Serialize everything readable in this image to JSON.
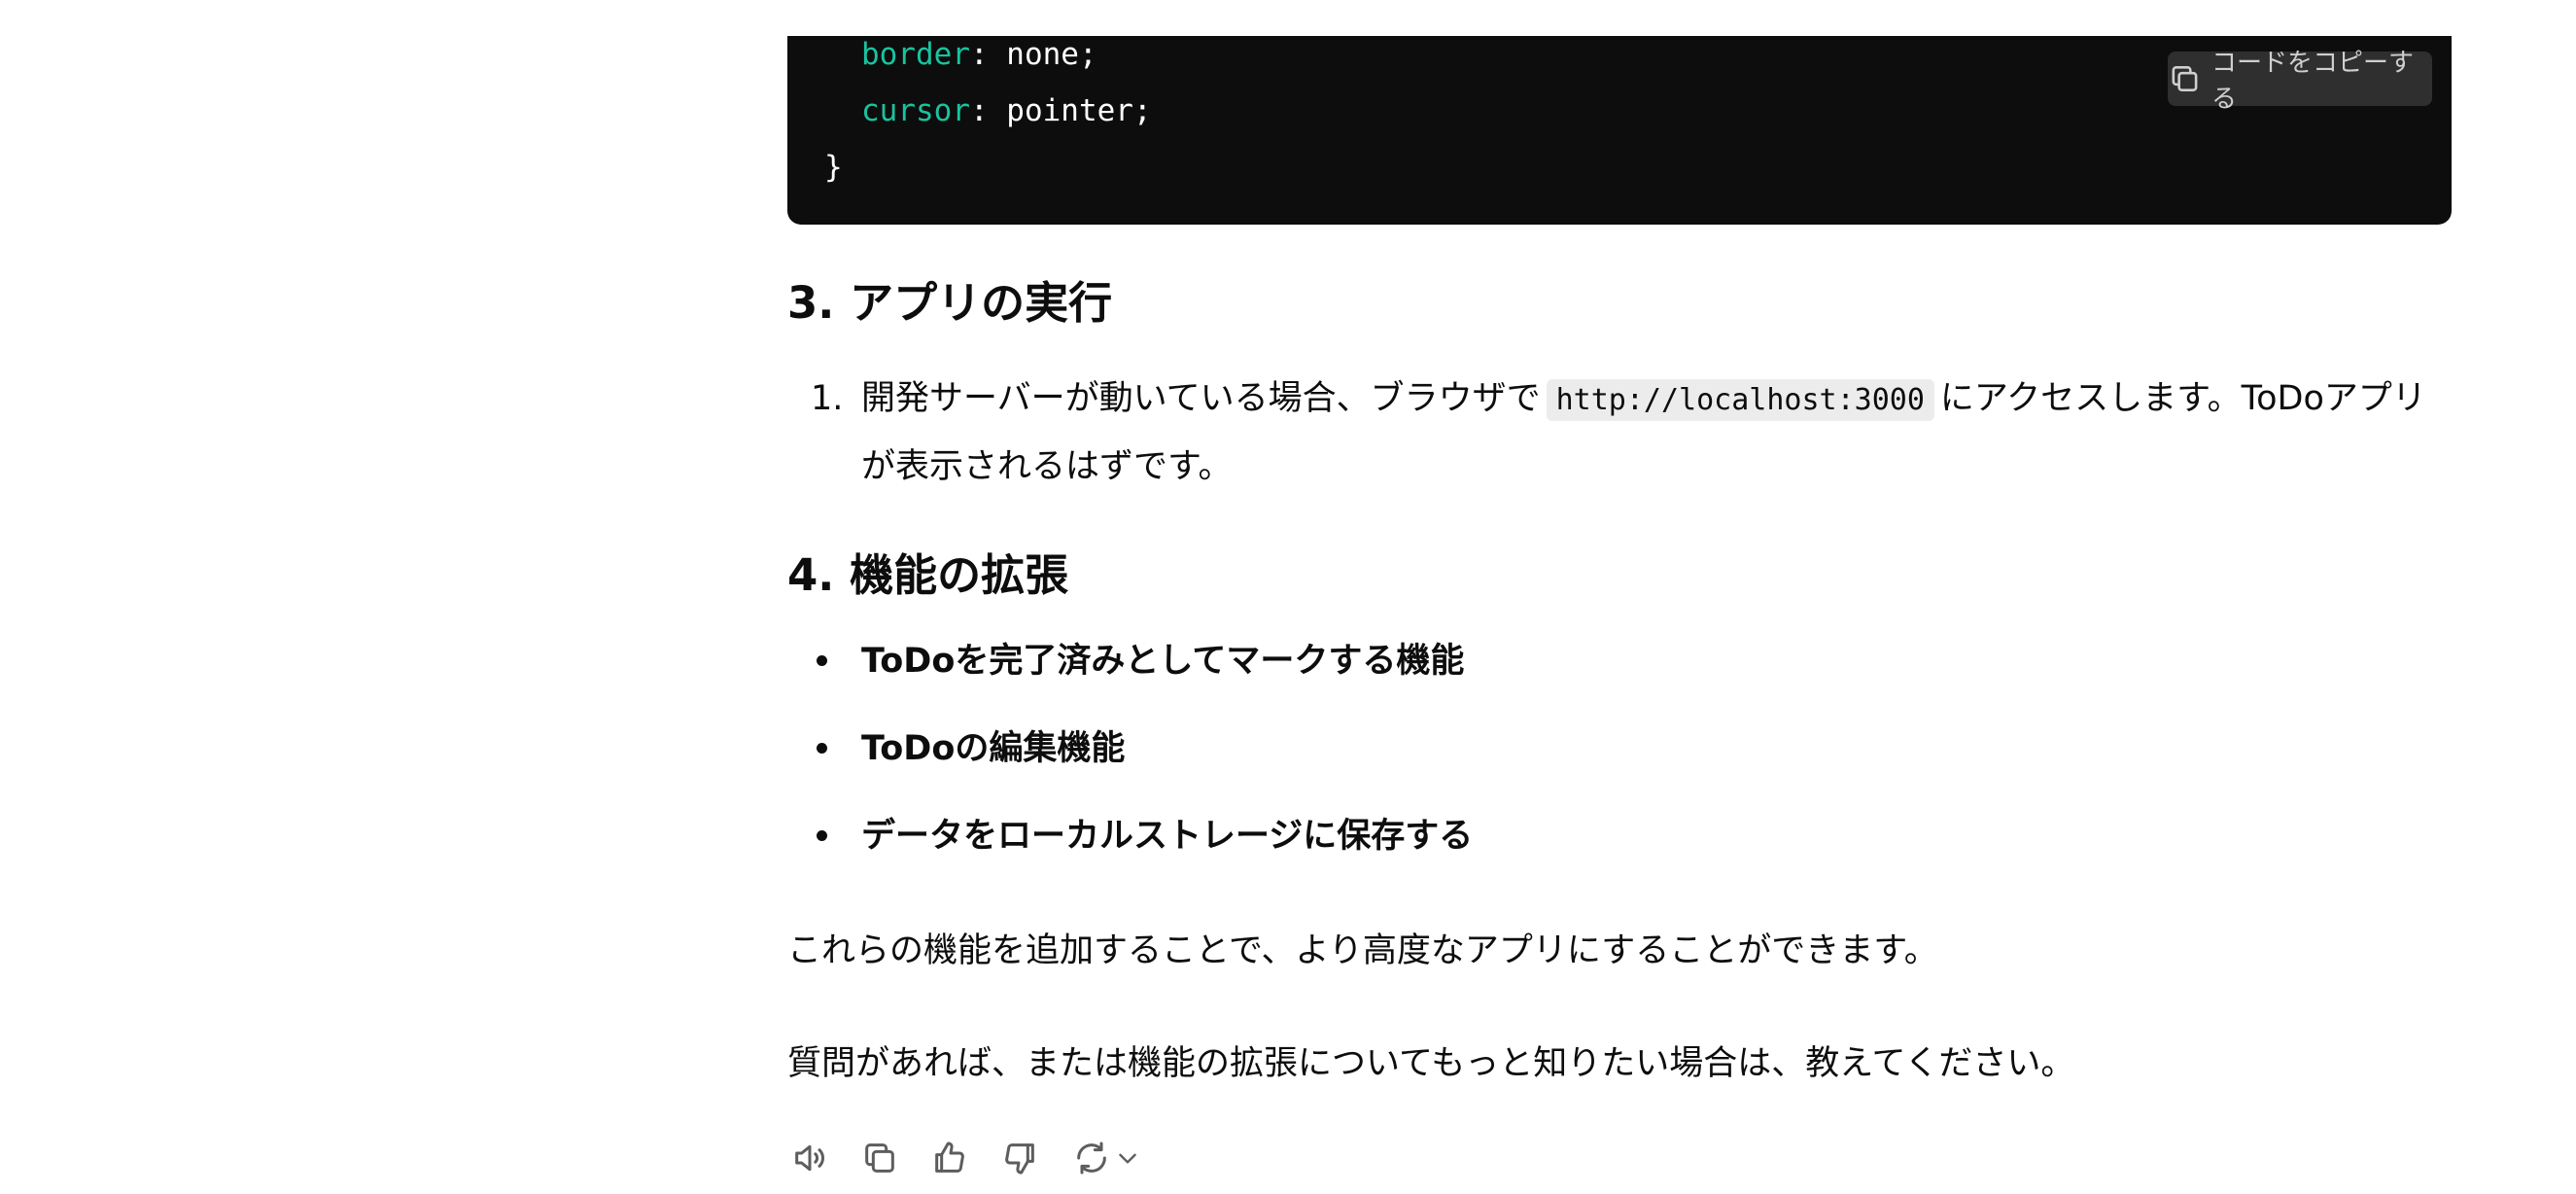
{
  "code_block": {
    "lines": [
      {
        "prop": "border",
        "rest": ": none;"
      },
      {
        "prop": "cursor",
        "rest": ": pointer;"
      },
      {
        "prop": "",
        "rest": "}"
      }
    ],
    "copy_label": "コードをコピーする",
    "copy_icon": "copy-icon"
  },
  "section3": {
    "heading": "3. アプリの実行",
    "item_number": "1.",
    "item_text_before": "開発サーバーが動いている場合、ブラウザで",
    "item_code": "http://localhost:3000",
    "item_text_after": "にアクセスします。ToDoアプリが表示されるはずです。"
  },
  "section4": {
    "heading": "4. 機能の拡張",
    "items": [
      "ToDoを完了済みとしてマークする機能",
      "ToDoの編集機能",
      "データをローカルストレージに保存する"
    ]
  },
  "paragraphs": [
    "これらの機能を追加することで、より高度なアプリにすることができます。",
    "質問があれば、または機能の拡張についてもっと知りたい場合は、教えてください。"
  ],
  "actions": [
    {
      "icon": "speaker-icon"
    },
    {
      "icon": "copy-icon"
    },
    {
      "icon": "thumbs-up-icon"
    },
    {
      "icon": "thumbs-down-icon"
    },
    {
      "icon": "regenerate-icon"
    }
  ]
}
